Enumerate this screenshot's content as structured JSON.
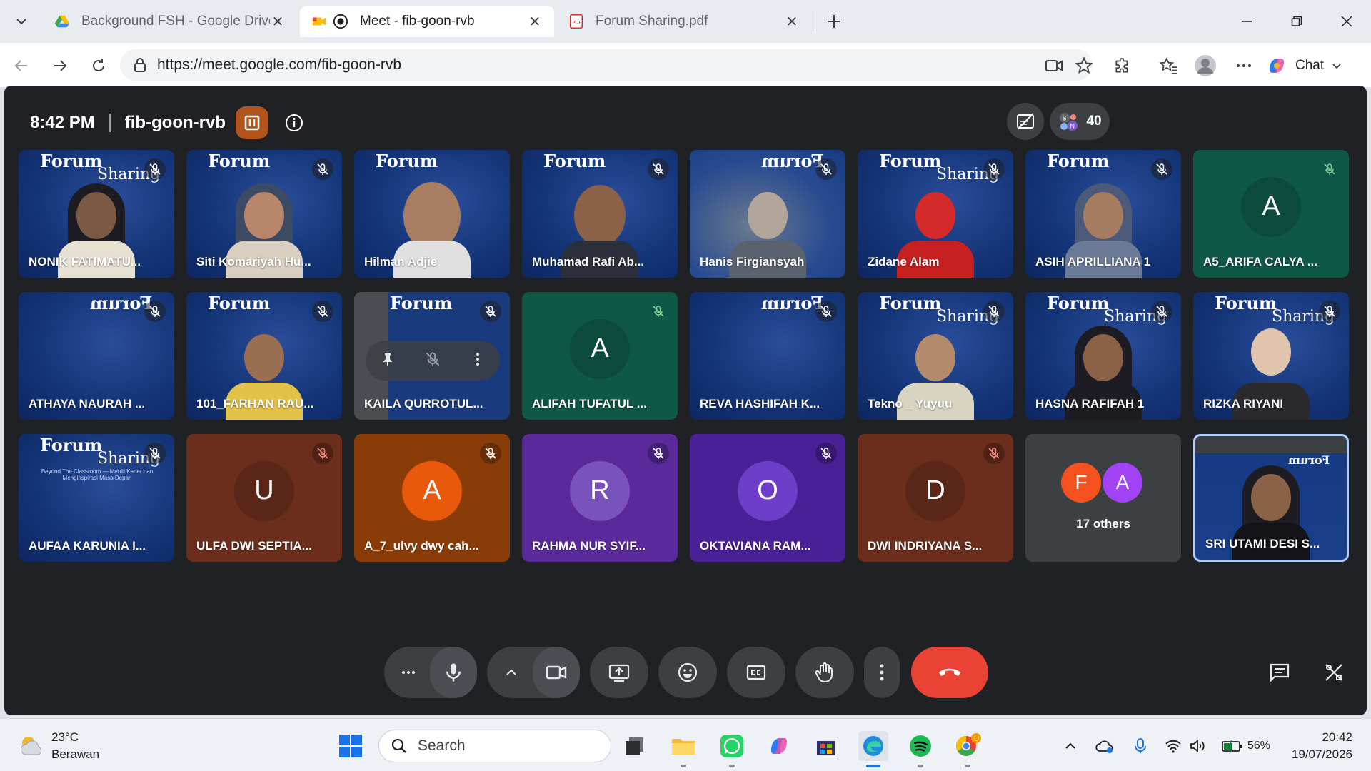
{
  "browser": {
    "tabs": [
      {
        "title": "Background FSH - Google Drive",
        "favicon": "google-drive-icon"
      },
      {
        "title": "Meet - fib-goon-rvb",
        "favicon": "google-meet-icon",
        "active": true
      },
      {
        "title": "Forum Sharing.pdf",
        "favicon": "pdf-icon"
      }
    ],
    "url": "https://meet.google.com/fib-goon-rvb",
    "chat_label": "Chat"
  },
  "meet": {
    "time": "8:42 PM",
    "code": "fib-goon-rvb",
    "people_count": "40",
    "participants_row1": [
      {
        "name": "NONIK FATIMATU..."
      },
      {
        "name": "Siti Komariyah Hu..."
      },
      {
        "name": "Hilman Adjie"
      },
      {
        "name": "Muhamad Rafi Ab..."
      },
      {
        "name": "Hanis Firgiansyah"
      },
      {
        "name": "Zidane Alam"
      },
      {
        "name": "ASIH APRILLIANA 1"
      },
      {
        "name": "A5_ARIFA CALYA ...",
        "initial": "A"
      }
    ],
    "participants_row2": [
      {
        "name": "ATHAYA NAURAH ..."
      },
      {
        "name": "101_FARHAN RAU..."
      },
      {
        "name": "KAILA QURROTUL..."
      },
      {
        "name": "ALIFAH TUFATUL ...",
        "initial": "A"
      },
      {
        "name": "REVA HASHIFAH K..."
      },
      {
        "name": "Tekno _ Yuyuu"
      },
      {
        "name": "HASNA RAFIFAH 1"
      },
      {
        "name": "RIZKA RIYANI"
      }
    ],
    "participants_row3": [
      {
        "name": "AUFAA KARUNIA I..."
      },
      {
        "name": "ULFA DWI SEPTIA...",
        "initial": "U"
      },
      {
        "name": "A_7_ulvy dwy cah...",
        "initial": "A"
      },
      {
        "name": "RAHMA NUR SYIF...",
        "initial": "R"
      },
      {
        "name": "OKTAVIANA RAM...",
        "initial": "O"
      },
      {
        "name": "DWI INDRIYANA S...",
        "initial": "D"
      },
      {
        "name": "SRI UTAMI DESI S..."
      }
    ],
    "others": {
      "label": "17 others",
      "initials": [
        "F",
        "A"
      ]
    },
    "background_text": {
      "title1": "Forum",
      "title2": "Sharing",
      "tagline": "Beyond The Classroom — Meniti Karier dan Menginspirasi Masa Depan"
    },
    "colors": {
      "end_call": "#ea4335",
      "meet_bg": "#202124",
      "tile_blue": "#143578"
    }
  },
  "taskbar": {
    "temperature": "23°C",
    "weather": "Berawan",
    "search_placeholder": "Search",
    "battery": "56%",
    "time": "20:42",
    "date": "19/07/2026"
  }
}
